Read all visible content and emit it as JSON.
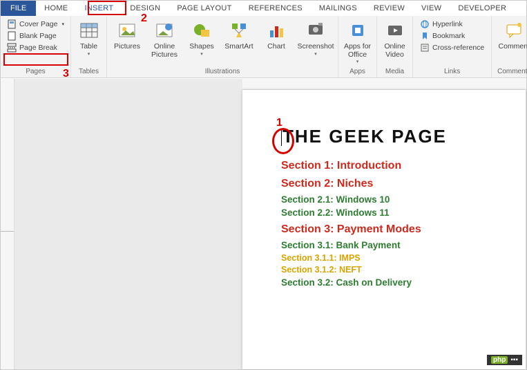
{
  "menubar": {
    "file": "FILE",
    "tabs": [
      "HOME",
      "INSERT",
      "DESIGN",
      "PAGE LAYOUT",
      "REFERENCES",
      "MAILINGS",
      "REVIEW",
      "VIEW",
      "DEVELOPER"
    ],
    "active_index": 1
  },
  "ribbon": {
    "pages": {
      "label": "Pages",
      "items": [
        "Cover Page",
        "Blank Page",
        "Page Break"
      ]
    },
    "tables": {
      "label": "Tables",
      "btn": "Table"
    },
    "illustrations": {
      "label": "Illustrations",
      "pictures": "Pictures",
      "online_pictures": "Online\nPictures",
      "shapes": "Shapes",
      "smartart": "SmartArt",
      "chart": "Chart",
      "screenshot": "Screenshot"
    },
    "apps": {
      "label": "Apps",
      "btn": "Apps for\nOffice"
    },
    "media": {
      "label": "Media",
      "btn": "Online\nVideo"
    },
    "links": {
      "label": "Links",
      "items": [
        "Hyperlink",
        "Bookmark",
        "Cross-reference"
      ]
    },
    "comments": {
      "label": "Comments",
      "btn": "Comment"
    }
  },
  "document": {
    "title": "THE GEEK PAGE",
    "lines": [
      {
        "cls": "h1",
        "text": "Section 1: Introduction"
      },
      {
        "cls": "h1",
        "text": "Section 2: Niches"
      },
      {
        "cls": "h2",
        "text": "Section 2.1: Windows 10"
      },
      {
        "cls": "h2",
        "text": "Section 2.2: Windows 11"
      },
      {
        "cls": "h1",
        "text": "Section 3: Payment Modes"
      },
      {
        "cls": "h2",
        "text": "Section 3.1: Bank Payment"
      },
      {
        "cls": "h3",
        "text": "Section 3.1.1: IMPS"
      },
      {
        "cls": "h3",
        "text": "Section 3.1.2: NEFT"
      },
      {
        "cls": "h2",
        "text": "Section 3.2: Cash on Delivery"
      }
    ]
  },
  "annotations": {
    "n1": "1",
    "n2": "2",
    "n3": "3"
  },
  "watermark": {
    "brand": "php",
    "rest": "▪▪▪"
  }
}
